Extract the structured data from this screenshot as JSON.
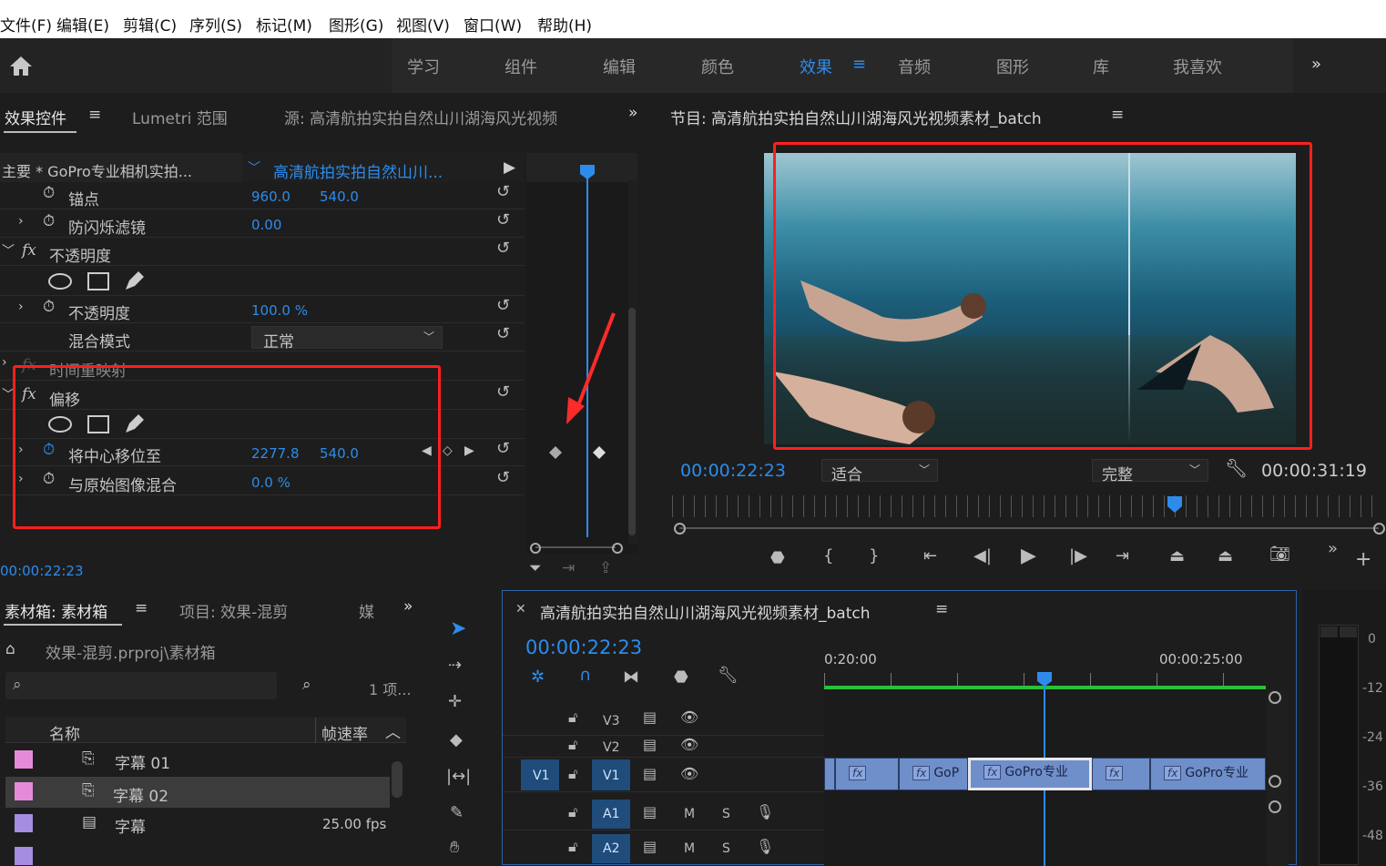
{
  "menu": [
    "文件(F)",
    "编辑(E)",
    "剪辑(C)",
    "序列(S)",
    "标记(M)",
    "图形(G)",
    "视图(V)",
    "窗口(W)",
    "帮助(H)"
  ],
  "workspaces": [
    "学习",
    "组件",
    "编辑",
    "颜色",
    "效果",
    "音频",
    "图形",
    "库",
    "我喜欢"
  ],
  "workspace_active": "效果",
  "effect_controls": {
    "tab_active": "效果控件",
    "tab_lumetri": "Lumetri 范围",
    "tab_source": "源: 高清航拍实拍自然山川湖海风光视频",
    "master": "主要 * GoPro专业相机实拍...",
    "clip": "高清航拍实拍自然山川...",
    "anchor": {
      "label": "锚点",
      "x": "960.0",
      "y": "540.0"
    },
    "flicker": {
      "label": "防闪烁滤镜",
      "value": "0.00"
    },
    "opacity_section": "不透明度",
    "opacity": {
      "label": "不透明度",
      "value": "100.0 %"
    },
    "blend": {
      "label": "混合模式",
      "value": "正常"
    },
    "time_remap": "时间重映射",
    "offset_section": "偏移",
    "shift_center": {
      "label": "将中心移位至",
      "x": "2277.8",
      "y": "540.0"
    },
    "blend_original": {
      "label": "与原始图像混合",
      "value": "0.0 %"
    },
    "timecode": "00:00:22:23"
  },
  "program": {
    "title": "节目: 高清航拍实拍自然山川湖海风光视频素材_batch",
    "timecode": "00:00:22:23",
    "fit": "适合",
    "quality": "完整",
    "duration": "00:00:31:19",
    "playhead": 0.71
  },
  "bin": {
    "tab": "素材箱: 素材箱",
    "tab2": "项目: 效果-混剪",
    "tab3": "媒",
    "path": "效果-混剪.prproj\\素材箱",
    "count": "1 项...",
    "col_name": "名称",
    "col_fps": "帧速率",
    "items": [
      {
        "name": "字幕 01",
        "fps": "",
        "color": "#e58ad9"
      },
      {
        "name": "字幕 02",
        "fps": "",
        "color": "#e58ad9"
      },
      {
        "name": "字幕",
        "fps": "25.00 fps",
        "color": "#a58de0"
      },
      {
        "name": "",
        "fps": "",
        "color": "#a58de0"
      }
    ]
  },
  "timeline": {
    "title": "高清航拍实拍自然山川湖海风光视频素材_batch",
    "timecode": "00:00:22:23",
    "ruler": [
      "0:20:00",
      "00:00:25:00"
    ],
    "tracks": [
      "V3",
      "V2",
      "V1",
      "A1",
      "A2"
    ],
    "source_v1": "V1",
    "mute": "M",
    "solo": "S",
    "clips": [
      "",
      "GoP",
      "GoPro专业",
      "",
      "GoPro专业"
    ]
  },
  "meter": [
    "0",
    "-12",
    "-24",
    "-36",
    "-48"
  ],
  "colors": {
    "accent": "#2d8ceb",
    "highlight": "#ff1f1f",
    "v1clip": "#6f8fcb"
  }
}
